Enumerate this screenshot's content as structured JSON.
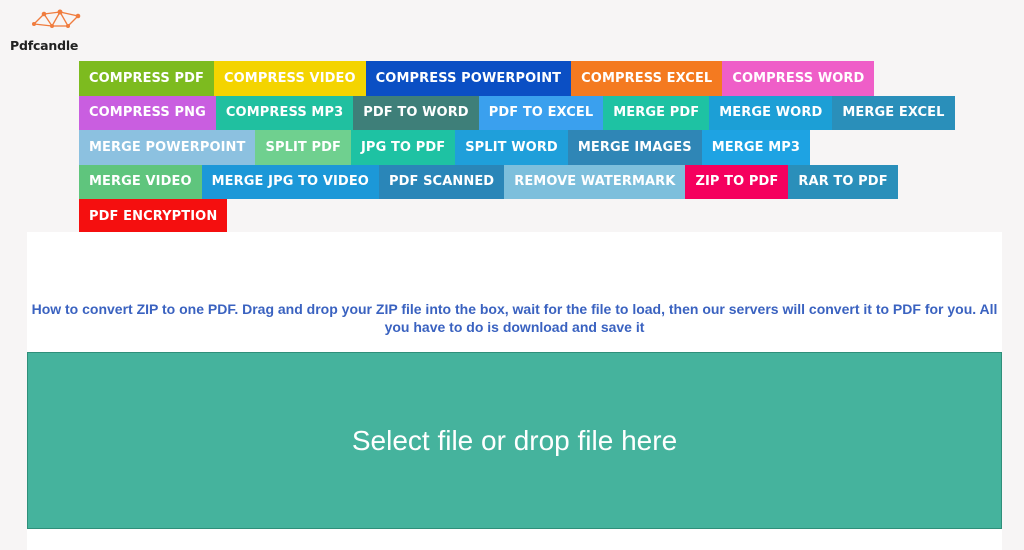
{
  "logo": {
    "text": "Pdfcandle",
    "icon": "network-nodes-logo",
    "accent": "#f07c3e"
  },
  "tool_rows": [
    [
      {
        "label": "COMPRESS PDF",
        "color": "#7dbb1f"
      },
      {
        "label": "COMPRESS VIDEO",
        "color": "#f4d400"
      },
      {
        "label": "COMPRESS POWERPOINT",
        "color": "#0b4fc4"
      },
      {
        "label": "COMPRESS EXCEL",
        "color": "#f47a20"
      },
      {
        "label": "COMPRESS WORD",
        "color": "#ef5ec8"
      }
    ],
    [
      {
        "label": "COMPRESS PNG",
        "color": "#c95ee0"
      },
      {
        "label": "COMPRESS MP3",
        "color": "#20c0a0"
      },
      {
        "label": "PDF TO WORD",
        "color": "#3e7f79"
      },
      {
        "label": "PDF TO EXCEL",
        "color": "#3aa0ee"
      },
      {
        "label": "MERGE PDF",
        "color": "#1ec2a3"
      },
      {
        "label": "MERGE WORD",
        "color": "#1c9fd6"
      },
      {
        "label": "MERGE EXCEL",
        "color": "#2a8fba"
      }
    ],
    [
      {
        "label": "MERGE POWERPOINT",
        "color": "#8cc1e0"
      },
      {
        "label": "SPLIT PDF",
        "color": "#6fd08f"
      },
      {
        "label": "JPG TO PDF",
        "color": "#1ec2a3"
      },
      {
        "label": "SPLIT WORD",
        "color": "#1f9fda"
      },
      {
        "label": "MERGE IMAGES",
        "color": "#2f86b6"
      },
      {
        "label": "MERGE MP3",
        "color": "#1ea3e3"
      }
    ],
    [
      {
        "label": "MERGE VIDEO",
        "color": "#5fc57d"
      },
      {
        "label": "MERGE JPG TO VIDEO",
        "color": "#1c98d8"
      },
      {
        "label": "PDF SCANNED",
        "color": "#2a86b8"
      },
      {
        "label": "REMOVE WATERMARK",
        "color": "#7dbfdc"
      },
      {
        "label": "ZIP TO PDF",
        "color": "#f5005e"
      },
      {
        "label": "RAR TO PDF",
        "color": "#2a8fba"
      }
    ],
    [
      {
        "label": "PDF ENCRYPTION",
        "color": "#f50f0f"
      }
    ]
  ],
  "instructions": "How to convert ZIP to one PDF. Drag and drop your ZIP file into the box, wait for the file to load, then our servers will convert it to PDF for you. All you have to do is download and save it",
  "dropzone": {
    "label": "Select file or drop file here",
    "color": "#45b39d"
  }
}
